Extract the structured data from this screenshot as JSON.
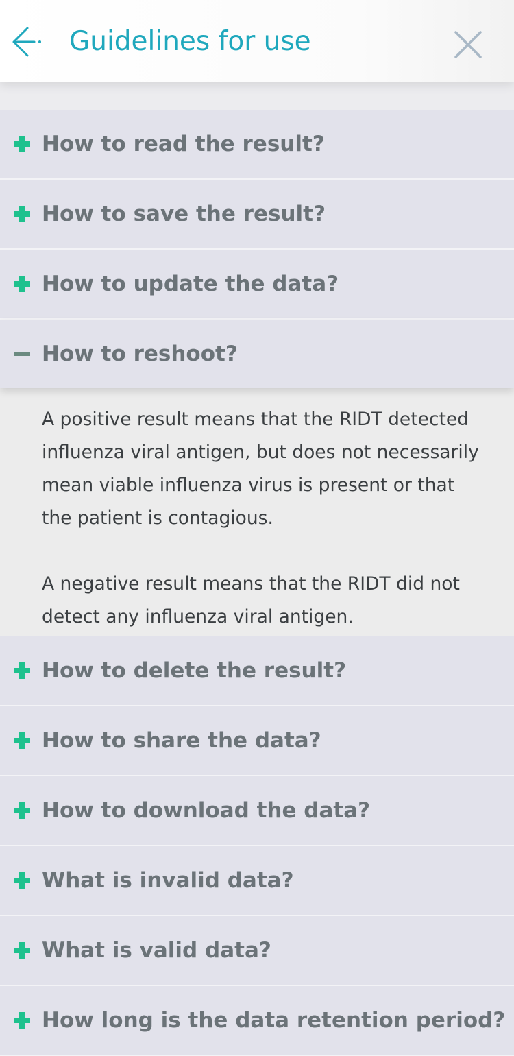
{
  "header": {
    "title": "Guidelines for use",
    "back_icon": "arrow-left-icon",
    "close_icon": "close-icon",
    "accent_color": "#1fa8bd"
  },
  "faq": {
    "items": [
      {
        "label": "How to read the result?",
        "expanded": false
      },
      {
        "label": "How to save the result?",
        "expanded": false
      },
      {
        "label": "How to update the data?",
        "expanded": false
      },
      {
        "label": "How to reshoot?",
        "expanded": true
      },
      {
        "label": "How to delete the result?",
        "expanded": false
      },
      {
        "label": "How to share the data?",
        "expanded": false
      },
      {
        "label": "How to download the data?",
        "expanded": false
      },
      {
        "label": "What is invalid data?",
        "expanded": false
      },
      {
        "label": "What is valid data?",
        "expanded": false
      },
      {
        "label": "How long is the data retention period?",
        "expanded": false
      }
    ],
    "expanded_answer": {
      "paragraph_1": "A positive result means that the RIDT detected influenza viral antigen, but does not necessarily mean viable influenza virus is present or that the patient is contagious.",
      "paragraph_2": "A negative result means that the RIDT did not detect any influenza viral antigen."
    },
    "plus_color": "#1ec18d",
    "minus_color": "#6b8a80"
  }
}
